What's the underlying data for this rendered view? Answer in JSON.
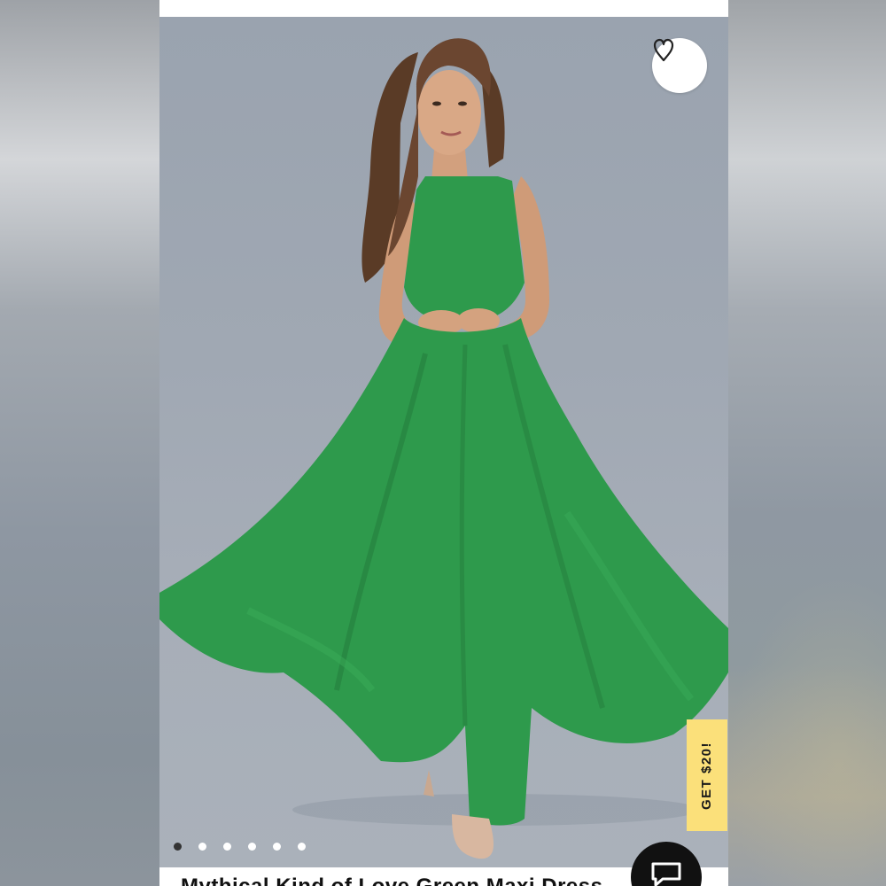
{
  "product": {
    "title": "Mythical Kind of Love Green Maxi Dress",
    "image_alt": "Model wearing green maxi dress"
  },
  "favorite": {
    "icon": "heart-outline-icon"
  },
  "carousel": {
    "total_slides": 6,
    "active_index": 0
  },
  "promo": {
    "label": "GET $20!",
    "color": "#fbe07a"
  },
  "chat": {
    "icon": "chat-bubble-icon"
  },
  "colors": {
    "dress_green": "#2e9a4c",
    "backdrop": "#a0a8b3"
  }
}
